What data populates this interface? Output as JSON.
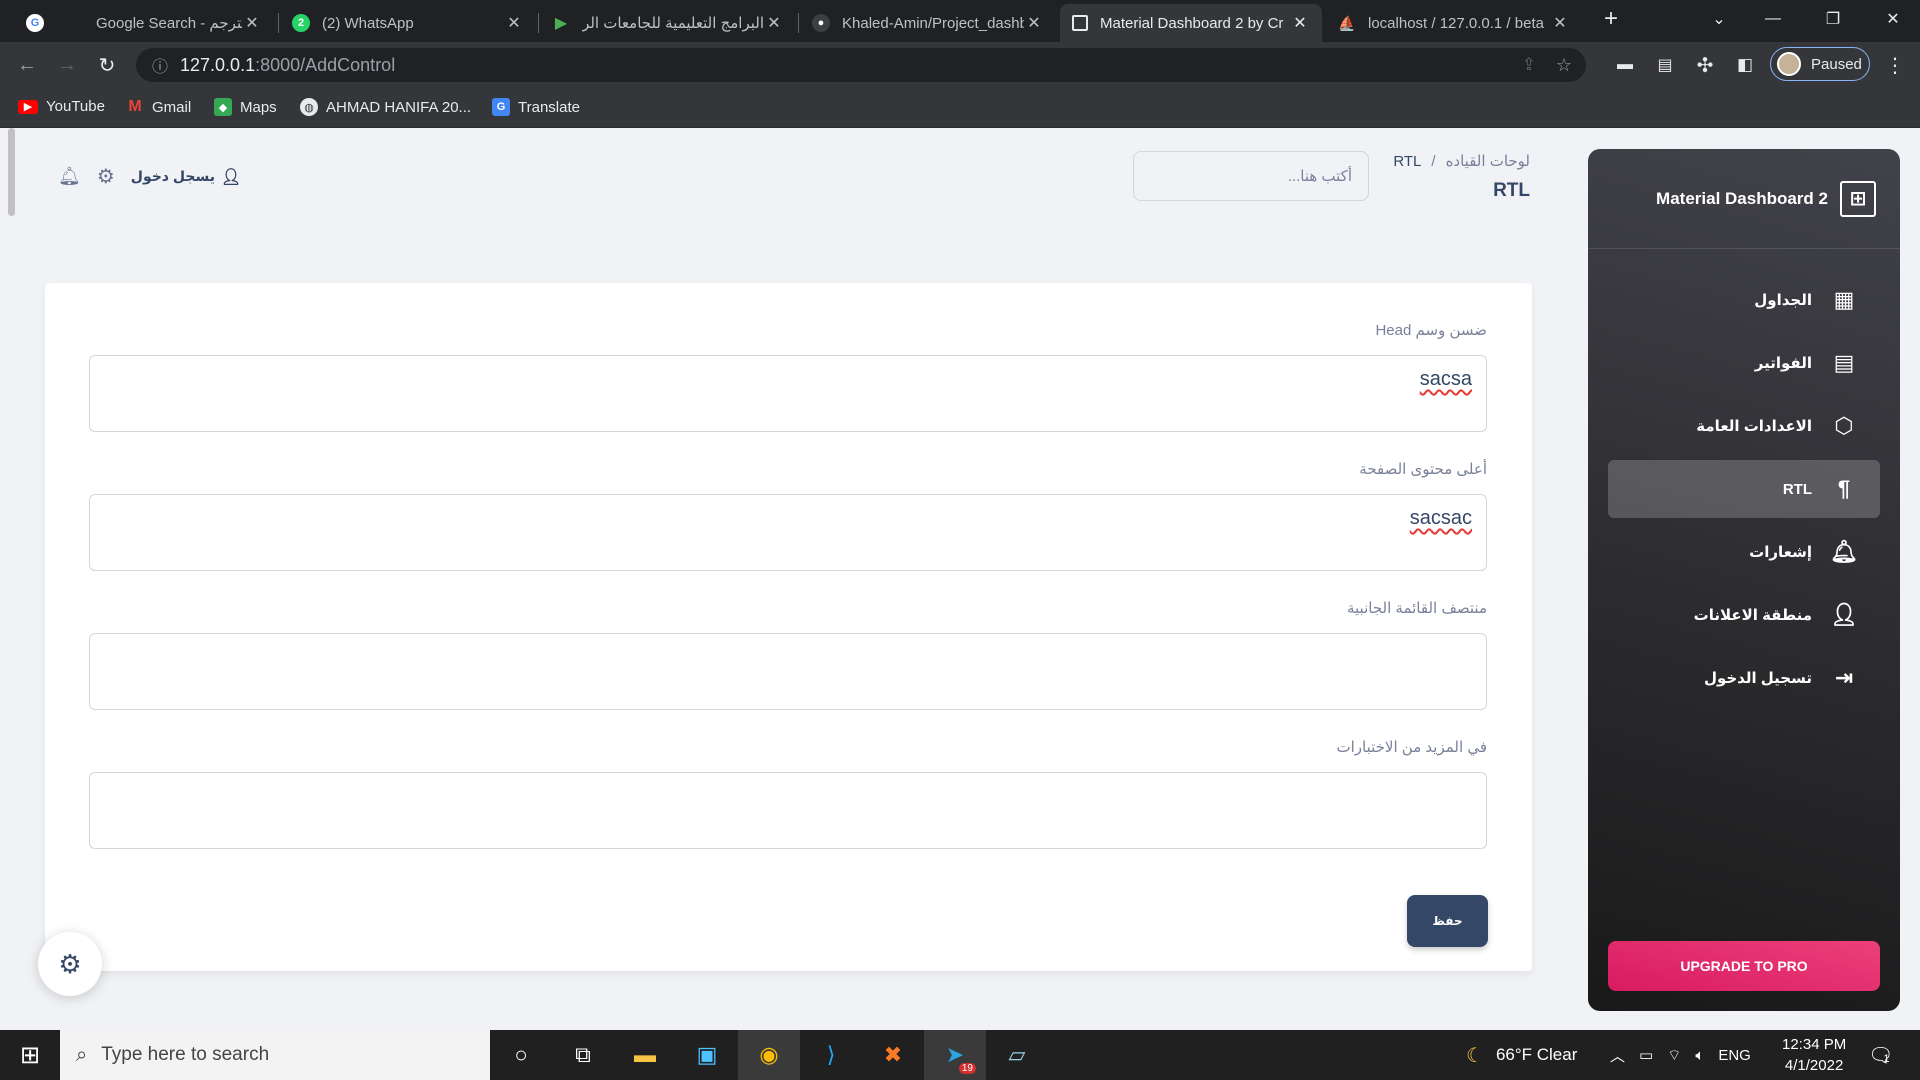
{
  "browser": {
    "tabs": [
      {
        "title": "Google Search - مترجم",
        "icon": "google-icon",
        "color": "#ffffff"
      },
      {
        "title": "(2) WhatsApp",
        "icon": "whatsapp-icon",
        "color": "#25d366"
      },
      {
        "title": "البرامج التعليمية للجامعات الر",
        "icon": "play-icon",
        "color": "#4caf50"
      },
      {
        "title": "Khaled-Amin/Project_dashb",
        "icon": "github-icon",
        "color": "#ffffff"
      },
      {
        "title": "Material Dashboard 2 by Cr",
        "icon": "dashboard-icon",
        "color": "#ffffff",
        "active": true
      },
      {
        "title": "localhost / 127.0.0.1 / beta",
        "icon": "phpmyadmin-icon",
        "color": "#f29111"
      }
    ],
    "url_host": "127.0.0.1",
    "url_path": ":8000/AddControl",
    "profile_status": "Paused",
    "bookmarks": [
      {
        "label": "YouTube",
        "icon": "youtube-icon"
      },
      {
        "label": "Gmail",
        "icon": "gmail-icon"
      },
      {
        "label": "Maps",
        "icon": "maps-icon"
      },
      {
        "label": "AHMAD HANIFA 20...",
        "icon": "globe-icon"
      },
      {
        "label": "Translate",
        "icon": "translate-icon"
      }
    ]
  },
  "navbar": {
    "breadcrumb_root": "لوحات القياده",
    "breadcrumb_current": "RTL",
    "title": "RTL",
    "search_placeholder": "أكتب هنا...",
    "signin_label": "يسجل دخول"
  },
  "form": {
    "fields": [
      {
        "label": "ضسن وسم Head",
        "value": "sacsa"
      },
      {
        "label": "أعلى محتوى الصفحة",
        "value": "sacsac"
      },
      {
        "label": "منتصف القائمة الجانبية",
        "value": ""
      },
      {
        "label": "في المزيد من الاختبارات",
        "value": ""
      }
    ],
    "save_label": "حفظ"
  },
  "sidebar": {
    "brand": "Material Dashboard 2",
    "items": [
      {
        "label": "الجداول",
        "icon": "table-icon"
      },
      {
        "label": "الفواتير",
        "icon": "receipt-icon"
      },
      {
        "label": "الاعدادات العامة",
        "icon": "settings-cube-icon"
      },
      {
        "label": "RTL",
        "icon": "paragraph-rtl-icon",
        "active": true
      },
      {
        "label": "إشعارات",
        "icon": "bell-icon"
      },
      {
        "label": "منطقة الاعلانات",
        "icon": "person-icon"
      },
      {
        "label": "تسجيل الدخول",
        "icon": "login-icon"
      }
    ],
    "upgrade_label": "UPGRADE TO PRO"
  },
  "taskbar": {
    "search_placeholder": "Type here to search",
    "weather": "66°F  Clear",
    "language": "ENG",
    "time": "12:34 PM",
    "date": "4/1/2022",
    "telegram_badge": "19",
    "notification_count": "1"
  }
}
